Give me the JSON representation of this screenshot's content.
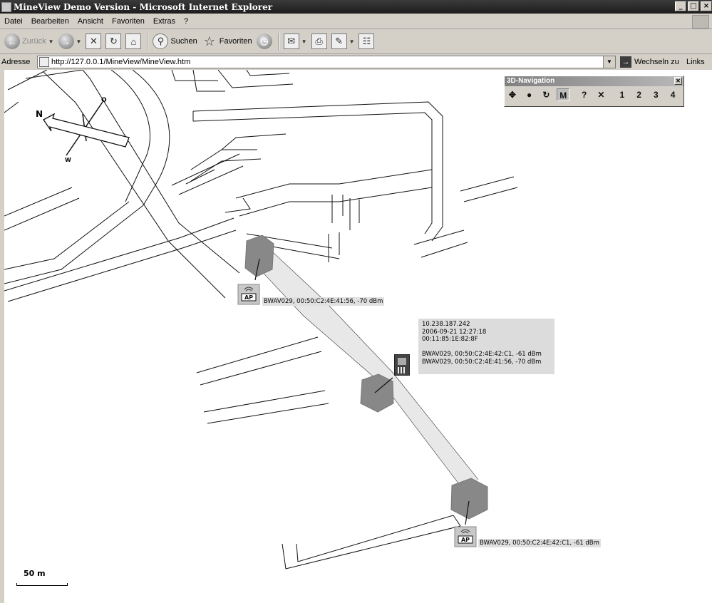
{
  "window": {
    "title": "MineView Demo Version - Microsoft Internet Explorer",
    "controls": [
      "_",
      "□",
      "×"
    ]
  },
  "menu": [
    "Datei",
    "Bearbeiten",
    "Ansicht",
    "Favoriten",
    "Extras",
    "?"
  ],
  "toolbar": {
    "back": "Zurück",
    "search": "Suchen",
    "favorites": "Favoriten"
  },
  "address": {
    "label": "Adresse",
    "url": "http://127.0.0.1/MineView/MineView.htm",
    "go": "Wechseln zu",
    "links": "Links"
  },
  "nav3d": {
    "title": "3D-Navigation",
    "buttons": [
      {
        "icon": "pan-icon",
        "glyph": "✥"
      },
      {
        "icon": "zoom-icon",
        "glyph": "●"
      },
      {
        "icon": "rotate-icon",
        "glyph": "↻"
      },
      {
        "icon": "select-icon",
        "glyph": "M"
      },
      {
        "icon": "query-icon",
        "glyph": "?"
      },
      {
        "icon": "cross-icon",
        "glyph": "✕"
      },
      {
        "icon": "view-1-icon",
        "glyph": "1"
      },
      {
        "icon": "view-2-icon",
        "glyph": "2"
      },
      {
        "icon": "view-3-icon",
        "glyph": "3"
      },
      {
        "icon": "view-4-icon",
        "glyph": "4"
      }
    ]
  },
  "map": {
    "compass": {
      "n": "N",
      "o": "O",
      "w": "W"
    },
    "scale": "50 m",
    "access_points": [
      {
        "icon": "AP",
        "label": "BWAV029, 00:50:C2:4E:41:56, -70 dBm"
      },
      {
        "icon": "AP",
        "label": "BWAV029, 00:50:C2:4E:42:C1, -61 dBm"
      }
    ],
    "device_info": [
      "10.238.187.242",
      "2006-09-21 12:27:18",
      "00:11:85:1E:82:8F",
      "",
      "BWAV029, 00:50:C2:4E:42:C1, -61 dBm",
      "BWAV029, 00:50:C2:4E:41:56, -70 dBm"
    ]
  }
}
